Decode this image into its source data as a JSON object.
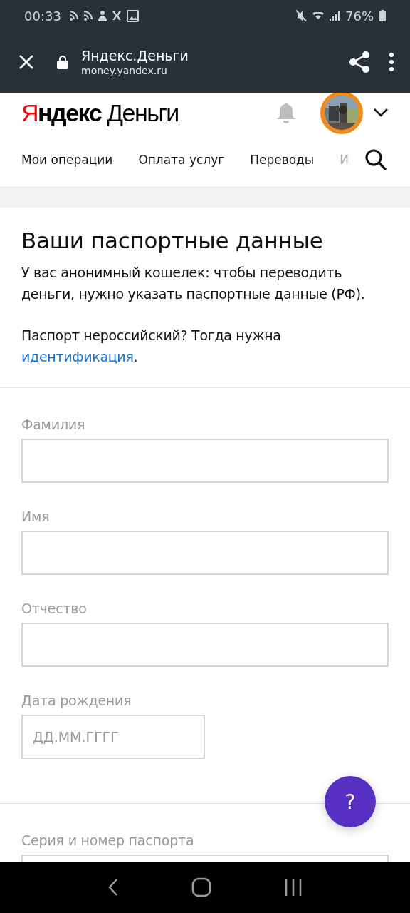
{
  "status_bar": {
    "time": "00:33",
    "battery": "76%"
  },
  "browser_bar": {
    "title": "Яндекс.Деньги",
    "url": "money.yandex.ru"
  },
  "header": {
    "logo_brand": "Яндекс",
    "logo_product": "Деньги"
  },
  "nav": [
    {
      "label": "Мои операции",
      "kind": "full"
    },
    {
      "label": "Оплата услуг",
      "kind": "full"
    },
    {
      "label": "Переводы",
      "kind": "full"
    },
    {
      "label": "И",
      "kind": "faded"
    }
  ],
  "intro": {
    "title": "Ваши паспортные данные",
    "text": "У вас анонимный кошелек: чтобы переводить деньги, нужно указать паспортные данные (РФ).",
    "note": "Паспорт нероссийский? Тогда нужна",
    "link": "идентификация",
    "after_link": "."
  },
  "sections": [
    {
      "fields": [
        {
          "label": "Фамилия",
          "kind": "wide"
        },
        {
          "label": "Имя",
          "kind": "wide"
        },
        {
          "label": "Отчество",
          "kind": "wide"
        },
        {
          "label": "Дата рождения",
          "kind": "narrow",
          "placeholder": "ДД.ММ.ГГГГ"
        }
      ]
    },
    {
      "fields": [
        {
          "label": "Серия и номер паспорта",
          "kind": "wide"
        }
      ]
    }
  ],
  "help_button": {
    "label": "?"
  }
}
